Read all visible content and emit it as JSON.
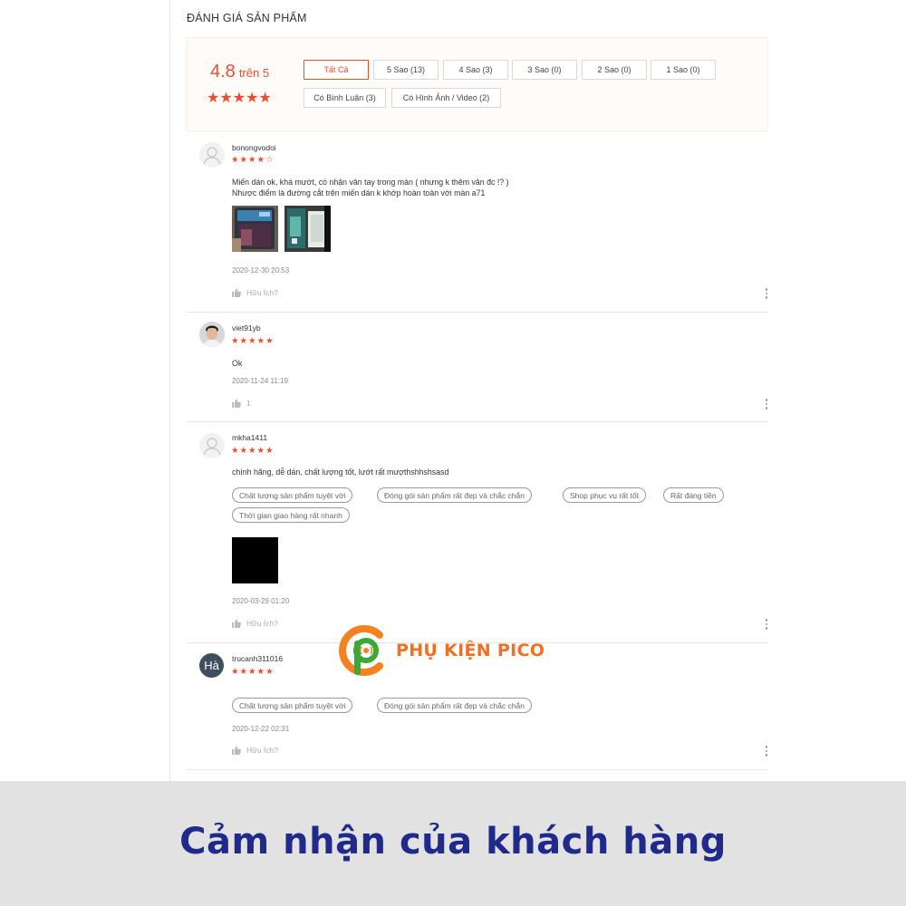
{
  "section_title": "ĐÁNH GIÁ SẢN PHẨM",
  "rating": {
    "score": "4.8",
    "out_of": "trên 5",
    "stars": "★★★★★"
  },
  "filters": {
    "all": "Tất Cả",
    "five": "5 Sao (13)",
    "four": "4 Sao (3)",
    "three": "3 Sao (0)",
    "two": "2 Sao (0)",
    "one": "1 Sao (0)",
    "with_comment": "Có Bình Luận (3)",
    "with_media": "Có Hình Ảnh / Video (2)"
  },
  "reviews": [
    {
      "username": "bonongvodoi",
      "stars": "★★★★",
      "empty_stars": "☆",
      "rating_value": 4,
      "comment_line1": "Miến dán ok, khá mướt, có nhận vân tay trong màn ( nhưng k thêm vân đc !? )",
      "comment_line2": "Nhược điểm là đường cắt trên miến dán k khớp hoàn toàn với màn a71",
      "date": "2020-12-30 20:53",
      "helpful": "Hữu Ích?"
    },
    {
      "username": "viet91yb",
      "stars": "★★★★★",
      "rating_value": 5,
      "comment": "Ok",
      "date": "2020-11-24 11:19",
      "helpful": "1"
    },
    {
      "username": "mkha1411",
      "stars": "★★★★★",
      "rating_value": 5,
      "comment": "chính hãng, dễ dán, chất lượng tốt, lướt rất mượthshhshsasd",
      "tags": [
        "Chất lượng sản phẩm tuyệt vời",
        "Đóng gói sản phẩm rất đẹp và chắc chắn",
        "Shop phục vụ rất tốt",
        "Rất đáng tiền",
        "Thời gian giao hàng rất nhanh"
      ],
      "date": "2020-03-29 01:20",
      "helpful": "Hữu Ích?"
    },
    {
      "username": "trucanh311016",
      "avatar_initials": "Hà",
      "stars": "★★★★★",
      "rating_value": 5,
      "tags": [
        "Chất lượng sản phẩm tuyệt vời",
        "Đóng gói sản phẩm rất đẹp và chắc chắn"
      ],
      "date": "2020-12-22 02:31",
      "helpful": "Hữu Ích?"
    }
  ],
  "logo": {
    "text": "PHỤ KIỆN PICO"
  },
  "caption": "Cảm nhận của khách hàng",
  "colors": {
    "accent": "#ee4d2d",
    "caption": "#1f2a8a",
    "logo": "#f26f21",
    "band": "#e2e2e2"
  }
}
